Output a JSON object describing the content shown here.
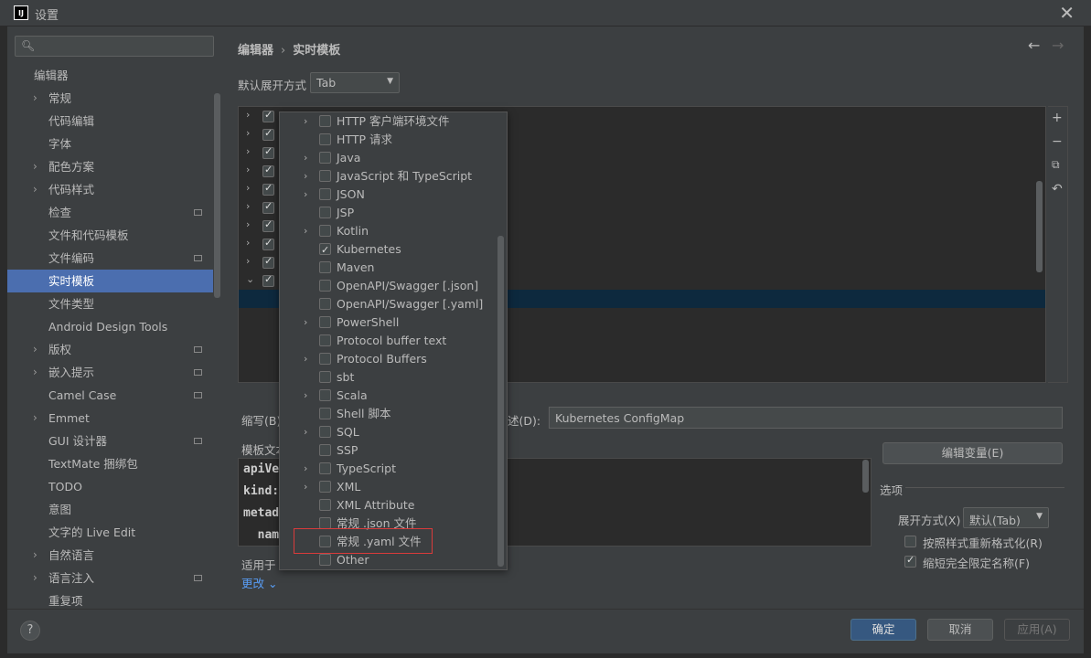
{
  "window": {
    "title": "设置",
    "app_icon": "IJ"
  },
  "search": {
    "placeholder": ""
  },
  "sidebar": {
    "items": [
      {
        "label": "编辑器",
        "chevron": false,
        "badge": false,
        "indent": 0,
        "selected": false
      },
      {
        "label": "常规",
        "chevron": true,
        "badge": false,
        "indent": 1,
        "selected": false
      },
      {
        "label": "代码编辑",
        "chevron": false,
        "badge": false,
        "indent": 1,
        "selected": false
      },
      {
        "label": "字体",
        "chevron": false,
        "badge": false,
        "indent": 1,
        "selected": false
      },
      {
        "label": "配色方案",
        "chevron": true,
        "badge": false,
        "indent": 1,
        "selected": false
      },
      {
        "label": "代码样式",
        "chevron": true,
        "badge": false,
        "indent": 1,
        "selected": false
      },
      {
        "label": "检查",
        "chevron": false,
        "badge": true,
        "indent": 1,
        "selected": false
      },
      {
        "label": "文件和代码模板",
        "chevron": false,
        "badge": false,
        "indent": 1,
        "selected": false
      },
      {
        "label": "文件编码",
        "chevron": false,
        "badge": true,
        "indent": 1,
        "selected": false
      },
      {
        "label": "实时模板",
        "chevron": false,
        "badge": false,
        "indent": 1,
        "selected": true
      },
      {
        "label": "文件类型",
        "chevron": false,
        "badge": false,
        "indent": 1,
        "selected": false
      },
      {
        "label": "Android Design Tools",
        "chevron": false,
        "badge": false,
        "indent": 1,
        "selected": false
      },
      {
        "label": "版权",
        "chevron": true,
        "badge": true,
        "indent": 1,
        "selected": false
      },
      {
        "label": "嵌入提示",
        "chevron": true,
        "badge": true,
        "indent": 1,
        "selected": false
      },
      {
        "label": "Camel Case",
        "chevron": false,
        "badge": true,
        "indent": 1,
        "selected": false
      },
      {
        "label": "Emmet",
        "chevron": true,
        "badge": false,
        "indent": 1,
        "selected": false
      },
      {
        "label": "GUI 设计器",
        "chevron": false,
        "badge": true,
        "indent": 1,
        "selected": false
      },
      {
        "label": "TextMate 捆绑包",
        "chevron": false,
        "badge": false,
        "indent": 1,
        "selected": false
      },
      {
        "label": "TODO",
        "chevron": false,
        "badge": false,
        "indent": 1,
        "selected": false
      },
      {
        "label": "意图",
        "chevron": false,
        "badge": false,
        "indent": 1,
        "selected": false
      },
      {
        "label": "文字的 Live Edit",
        "chevron": false,
        "badge": false,
        "indent": 1,
        "selected": false
      },
      {
        "label": "自然语言",
        "chevron": true,
        "badge": false,
        "indent": 1,
        "selected": false
      },
      {
        "label": "语言注入",
        "chevron": true,
        "badge": true,
        "indent": 1,
        "selected": false
      },
      {
        "label": "重复项",
        "chevron": false,
        "badge": false,
        "indent": 1,
        "selected": false
      }
    ]
  },
  "breadcrumb": {
    "parent": "编辑器",
    "separator": "›",
    "current": "实时模板"
  },
  "expand": {
    "label": "默认展开方式",
    "value": "Tab"
  },
  "tree": {
    "row_count": 10
  },
  "form": {
    "abbr_label": "缩写(B)",
    "desc_label": "述(D):",
    "desc_value": "Kubernetes ConfigMap",
    "template_label": "模板文本",
    "template_lines": [
      "apiVe",
      "kind:",
      "metad",
      "  nam"
    ],
    "edit_vars_label": "编辑变量(E)",
    "apply_label": "适用于",
    "change_link": "更改 ⌄"
  },
  "options": {
    "title": "选项",
    "expand_with_label": "展开方式(X)",
    "expand_with_value": "默认(Tab)",
    "reformat_label": "按照样式重新格式化(R)",
    "reformat_checked": false,
    "shorten_label": "缩短完全限定名称(F)",
    "shorten_checked": true
  },
  "popup": {
    "items": [
      {
        "label": "HTTP 客户端环境文件",
        "chevron": true,
        "checked": false
      },
      {
        "label": "HTTP 请求",
        "chevron": false,
        "checked": false
      },
      {
        "label": "Java",
        "chevron": true,
        "checked": false
      },
      {
        "label": "JavaScript 和 TypeScript",
        "chevron": true,
        "checked": false
      },
      {
        "label": "JSON",
        "chevron": true,
        "checked": false
      },
      {
        "label": "JSP",
        "chevron": false,
        "checked": false
      },
      {
        "label": "Kotlin",
        "chevron": true,
        "checked": false
      },
      {
        "label": "Kubernetes",
        "chevron": false,
        "checked": true
      },
      {
        "label": "Maven",
        "chevron": false,
        "checked": false
      },
      {
        "label": "OpenAPI/Swagger [.json]",
        "chevron": false,
        "checked": false
      },
      {
        "label": "OpenAPI/Swagger [.yaml]",
        "chevron": false,
        "checked": false
      },
      {
        "label": "PowerShell",
        "chevron": true,
        "checked": false
      },
      {
        "label": "Protocol buffer text",
        "chevron": false,
        "checked": false
      },
      {
        "label": "Protocol Buffers",
        "chevron": true,
        "checked": false
      },
      {
        "label": "sbt",
        "chevron": false,
        "checked": false
      },
      {
        "label": "Scala",
        "chevron": true,
        "checked": false
      },
      {
        "label": "Shell 脚本",
        "chevron": false,
        "checked": false
      },
      {
        "label": "SQL",
        "chevron": true,
        "checked": false
      },
      {
        "label": "SSP",
        "chevron": false,
        "checked": false
      },
      {
        "label": "TypeScript",
        "chevron": true,
        "checked": false
      },
      {
        "label": "XML",
        "chevron": true,
        "checked": false
      },
      {
        "label": "XML Attribute",
        "chevron": false,
        "checked": false
      },
      {
        "label": "常规 .json 文件",
        "chevron": false,
        "checked": false
      },
      {
        "label": "常规 .yaml 文件",
        "chevron": false,
        "checked": false
      },
      {
        "label": "Other",
        "chevron": false,
        "checked": false
      }
    ]
  },
  "footer": {
    "help": "?",
    "ok": "确定",
    "cancel": "取消",
    "apply": "应用(A)"
  },
  "colors": {
    "background": "#3c3f41",
    "selection": "#4b6eaf",
    "ok_button": "#365880",
    "highlight_border": "#d93b3b"
  }
}
